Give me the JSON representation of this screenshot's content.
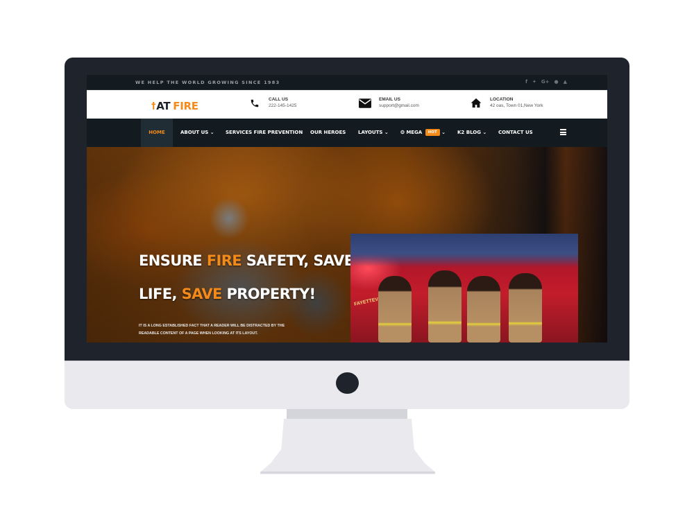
{
  "topbar": {
    "tagline": "WE HELP THE WORLD GROWING SINCE 1983",
    "social": [
      {
        "icon": "facebook-icon",
        "glyph": "f"
      },
      {
        "icon": "twitter-icon",
        "glyph": "✦"
      },
      {
        "icon": "google-plus-icon",
        "glyph": "G+"
      },
      {
        "icon": "pinterest-icon",
        "glyph": "●"
      },
      {
        "icon": "youtube-icon",
        "glyph": "▲"
      }
    ]
  },
  "header": {
    "logo": {
      "icon_glyph": "†",
      "part1": "AT",
      "part2": "FIRE"
    },
    "contacts": [
      {
        "icon": "phone-icon",
        "label": "CALL US",
        "value": "222-145-1425"
      },
      {
        "icon": "envelope-icon",
        "label": "EMAIL US",
        "value": "support@gmail.com"
      },
      {
        "icon": "home-icon",
        "label": "LOCATION",
        "value": "42 oas, Town 01,New York"
      }
    ]
  },
  "nav": {
    "items": [
      {
        "label": "HOME",
        "active": true
      },
      {
        "label": "ABOUT US ⌄"
      },
      {
        "label": "SERVICES FIRE PREVENTION"
      },
      {
        "label": "OUR HEROES"
      },
      {
        "label": "LAYOUTS ⌄"
      },
      {
        "label": "MEGA",
        "badge": "HOT",
        "caret": "⌄",
        "icon_glyph": "❂"
      },
      {
        "label": "K2 BLOG ⌄"
      },
      {
        "label": "CONTACT US"
      }
    ],
    "menu_icon": "hamburger-menu-icon"
  },
  "hero": {
    "title_line1_a": "ENSURE ",
    "title_line1_hl": "FIRE",
    "title_line1_b": " SAFETY, SAVE",
    "title_line2_a": "LIFE, ",
    "title_line2_hl": "SAVE",
    "title_line2_b": " PROPERTY!",
    "description": "It is a long established fact that a reader will be distracted by the readable content of a page when looking at its layout.",
    "photo_truck_text": "FAYETTEVI"
  },
  "colors": {
    "accent": "#f38a19",
    "nav_bg": "#141b20",
    "bezel": "#1f232b",
    "chin": "#e9e9ee"
  }
}
